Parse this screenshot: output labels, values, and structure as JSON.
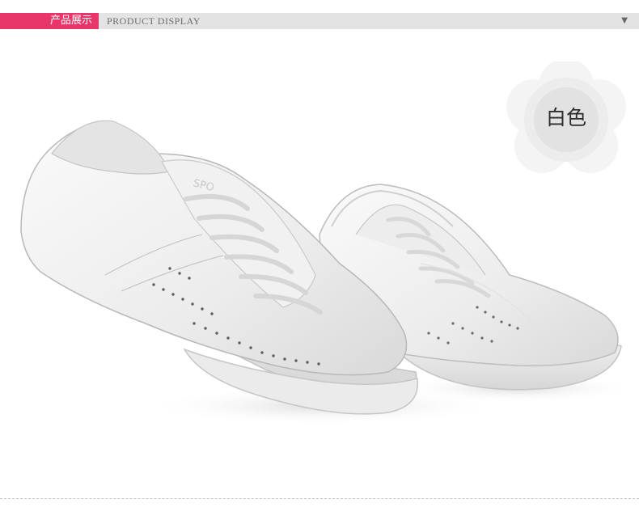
{
  "header": {
    "title_cn": "产品展示",
    "title_en": "PRODUCT DISPLAY",
    "arrow_icon": "caret-down-icon",
    "accent_color": "#e8366a"
  },
  "badge": {
    "color_label": "白色"
  },
  "photo": {
    "subject": "white-sneakers"
  }
}
